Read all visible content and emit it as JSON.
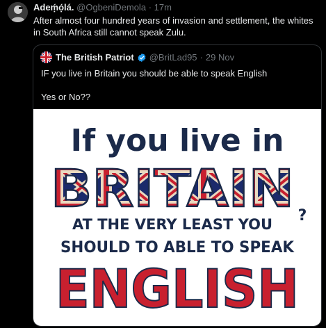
{
  "tweet": {
    "author_name": "Adeṃ́ọ́lá.",
    "author_handle": "@OgbeniDemola",
    "separator": "·",
    "time": "17m",
    "text": "After almost four hundred years of invasion and settlement, the whites in South Africa still cannot speak Zulu."
  },
  "quoted_tweet": {
    "author_name": "The British Patriot",
    "author_handle": "@BritLad95",
    "separator": "·",
    "time": "29 Nov",
    "text_line1": "IF you live in Britain you should be able to speak English",
    "text_line2": "Yes or No??"
  },
  "poster": {
    "line1": "If you live in",
    "line2": "BRITAIN",
    "line3": "AT THE VERY LEAST YOU",
    "question_mark": "?",
    "line4": "SHOULD TO ABLE TO SPEAK",
    "line5": "ENGLISH"
  },
  "colors": {
    "background": "#000000",
    "text_primary": "#e7e9ea",
    "text_secondary": "#71767b",
    "border": "#2f3336",
    "verified_blue": "#1d9bf0",
    "poster_navy": "#1b2a4a",
    "poster_red": "#c8202f",
    "poster_cream": "#e9d9c0"
  },
  "icons": [
    "profile-avatar",
    "union-flag-avatar",
    "verified-badge-icon"
  ]
}
